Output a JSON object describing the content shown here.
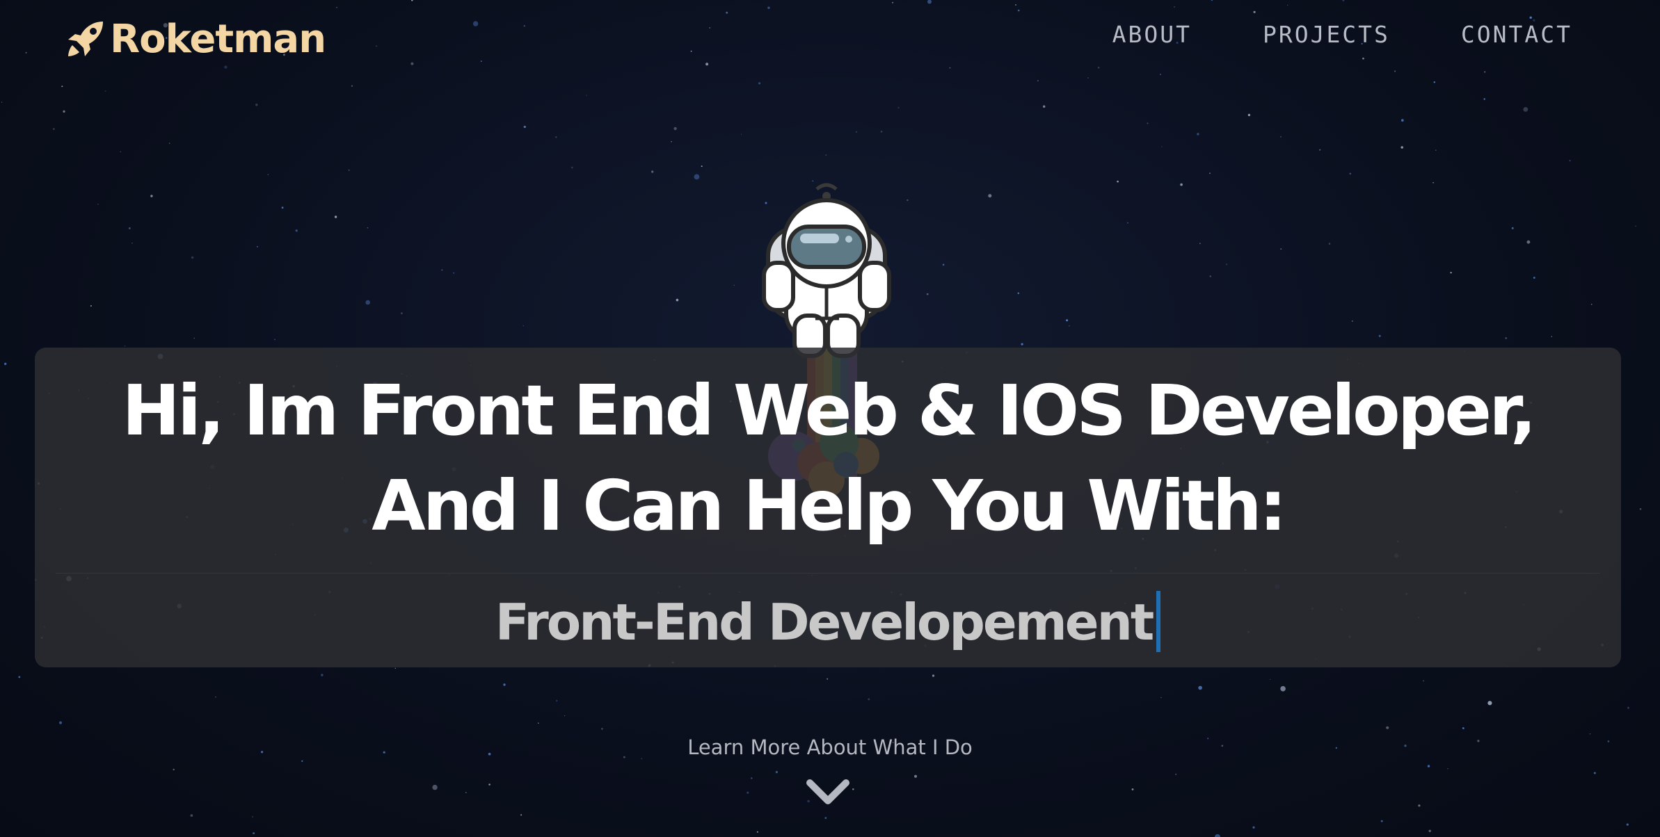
{
  "brand": {
    "name": "Roketman",
    "icon": "rocket-icon",
    "color": "#f3d6a3"
  },
  "nav": {
    "items": [
      {
        "label": "ABOUT"
      },
      {
        "label": "PROJECTS"
      },
      {
        "label": "CONTACT"
      }
    ]
  },
  "hero": {
    "title": "Hi, Im Front End Web & IOS Developer, And I Can Help You With:",
    "typed_text": "Front-End Developement",
    "caret_color": "#1f6fb4"
  },
  "learn_more": {
    "label": "Learn More About What I Do",
    "icon": "chevron-down-icon"
  },
  "colors": {
    "background": "#0b1020",
    "panel": "#2c2d32",
    "text": "#ffffff",
    "muted": "#b8bcc6"
  }
}
